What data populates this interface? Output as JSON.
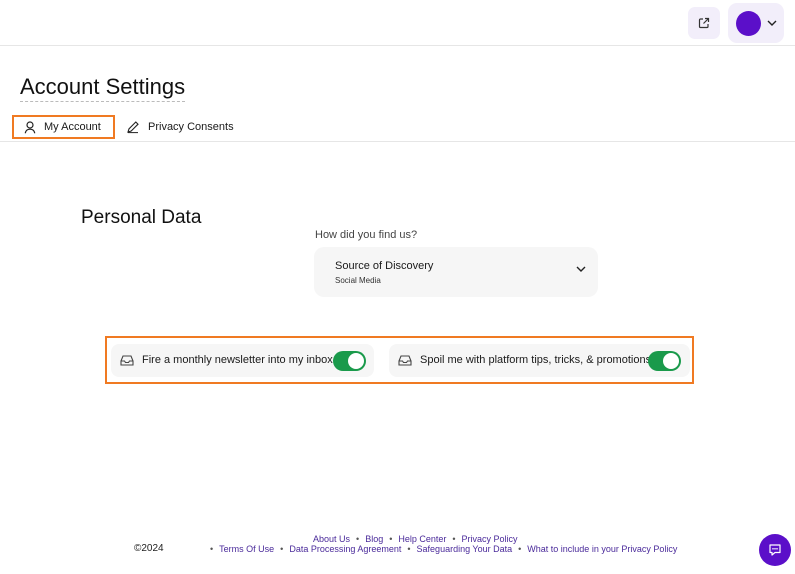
{
  "header": {
    "external_link_icon": "external-link-icon",
    "avatar_color": "#5b0fc9",
    "menu_chevron_icon": "chevron-down-icon"
  },
  "page": {
    "title": "Account Settings"
  },
  "tabs": [
    {
      "label": "My Account",
      "icon": "user-icon",
      "active": true
    },
    {
      "label": "Privacy Consents",
      "icon": "pencil-icon",
      "active": false
    }
  ],
  "personal_data": {
    "title": "Personal Data",
    "question_label": "How did you find us?",
    "select_label": "Source of Discovery",
    "select_value": "Social Media"
  },
  "toggles": [
    {
      "label": "Fire a monthly newsletter into my inbox",
      "icon": "inbox-icon",
      "on": true
    },
    {
      "label": "Spoil me with platform tips, tricks, & promotions",
      "icon": "inbox-icon",
      "on": true
    }
  ],
  "footer": {
    "copyright": "©2024",
    "row1": [
      "About Us",
      "Blog",
      "Help Center",
      "Privacy Policy"
    ],
    "row2": [
      "Terms Of Use",
      "Data Processing Agreement",
      "Safeguarding Your Data",
      "What to include in your Privacy Policy"
    ],
    "separator": "•",
    "chat_icon": "chat-icon"
  },
  "colors": {
    "accent": "#5b0fc9",
    "toggle_on": "#1a9a4b",
    "highlight": "#f07a22"
  }
}
